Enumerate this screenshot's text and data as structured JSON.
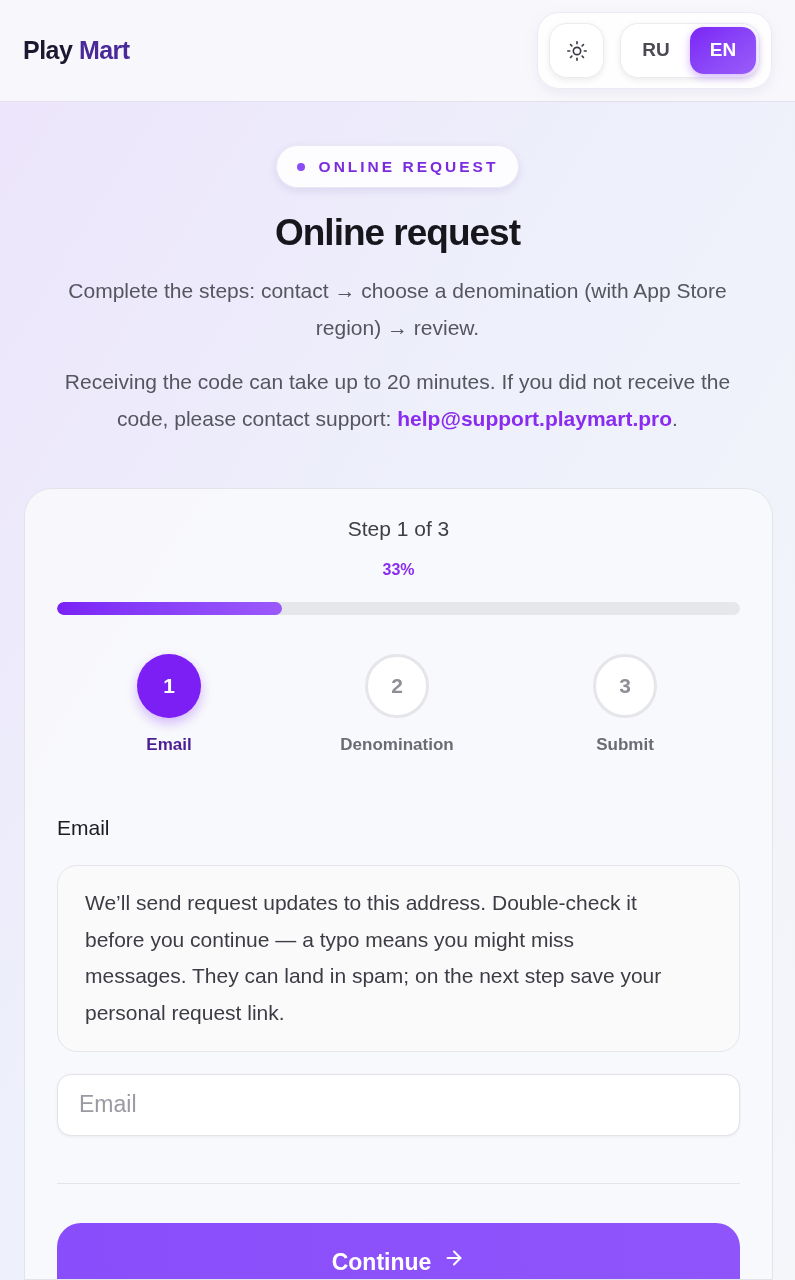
{
  "header": {
    "logo": [
      "Play",
      "Mart"
    ],
    "languages": [
      {
        "label": "RU",
        "selected": false
      },
      {
        "label": "EN",
        "selected": true
      }
    ]
  },
  "hero": {
    "badge": "ONLINE REQUEST",
    "title": "Online request",
    "intro": "Complete the steps: contact → choose a denomination (with App Store region) → review.",
    "notice": {
      "text": "Receiving the code can take up to 20 minutes. If you did not receive the code, please contact support: ",
      "link": "help@support.playmart.pro",
      "after": "."
    }
  },
  "form": {
    "step_label": "Step 1 of 3",
    "progress": {
      "reading": "33%",
      "level": 0.33
    },
    "steps": [
      {
        "number": "1",
        "label": "Email",
        "selected": true
      },
      {
        "number": "2",
        "label": "Denomination",
        "selected": false
      },
      {
        "number": "3",
        "label": "Submit",
        "selected": false
      }
    ],
    "field_label": "Email",
    "hint": "We’ll send request updates to this address. Double-check it before you continue — a typo means you might miss messages. They can land in spam; on the next step save your personal request link.",
    "email_input": {
      "placeholder": "Email"
    },
    "continue_button": "Continue"
  }
}
